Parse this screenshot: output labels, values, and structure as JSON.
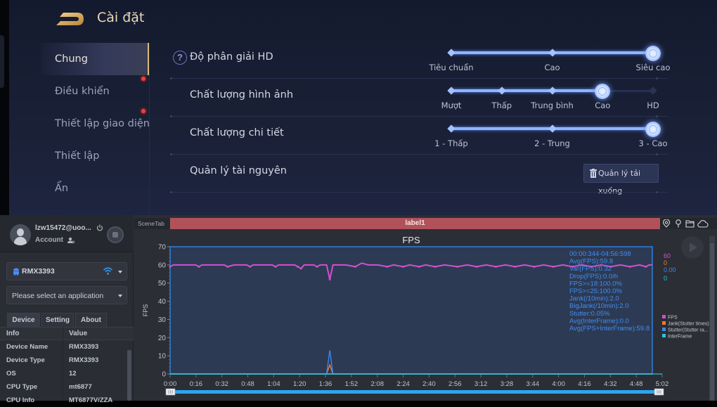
{
  "game_settings": {
    "title": "Cài đặt",
    "sidebar": [
      {
        "label": "Chung",
        "active": true,
        "badge": false
      },
      {
        "label": "Điều khiển",
        "active": false,
        "badge": true
      },
      {
        "label": "Thiết lập giao diện",
        "active": false,
        "badge": true
      },
      {
        "label": "Thiết lập",
        "active": false,
        "badge": false
      },
      {
        "label": "Ẩn",
        "active": false,
        "badge": false
      }
    ],
    "rows": [
      {
        "label": "Độ phân giải HD",
        "help": "?",
        "options": [
          "Tiêu chuẩn",
          "Cao",
          "Siêu cao"
        ],
        "selected_index": 2,
        "enabled_count": 3
      },
      {
        "label": "Chất lượng hình ảnh",
        "options": [
          "Mượt",
          "Thấp",
          "Trung bình",
          "Cao",
          "HD"
        ],
        "selected_index": 3,
        "enabled_count": 4
      },
      {
        "label": "Chất lượng chi tiết",
        "options": [
          "1 - Thấp",
          "2 - Trung",
          "3 - Cao"
        ],
        "selected_index": 2,
        "enabled_count": 3
      },
      {
        "label": "Quản lý tài nguyên",
        "button_label": "Quản lý tải xuống"
      }
    ]
  },
  "perf_tool": {
    "account": {
      "username": "lzw15472@uoo...",
      "label": "Account"
    },
    "device": {
      "name": "RMX3393"
    },
    "app_select": {
      "placeholder": "Please select an application"
    },
    "tabs": [
      "Device",
      "Setting",
      "About"
    ],
    "info_table": {
      "headers": [
        "Info",
        "Value"
      ],
      "rows": [
        [
          "Device Name",
          "RMX3393"
        ],
        [
          "Device Type",
          "RMX3393"
        ],
        [
          "OS",
          "12"
        ],
        [
          "CPU Type",
          "mt6877"
        ],
        [
          "CPU Info",
          "MT6877V/ZZA"
        ]
      ]
    },
    "scene_tab": "SceneTab",
    "label_bar": "label1",
    "colors": {
      "fps": "#d24fd0",
      "jank": "#f07d2a",
      "stutter": "#3d86ef",
      "interframe": "#27c6d8",
      "label_bar": "#b1525a"
    }
  },
  "chart_data": {
    "type": "line",
    "title": "FPS",
    "xlabel": "",
    "ylabel": "FPS",
    "ylim": [
      0,
      70
    ],
    "yticks": [
      0,
      10,
      20,
      30,
      40,
      50,
      60,
      70
    ],
    "xlim_seconds": [
      0,
      302
    ],
    "xtick_labels": [
      "0:00",
      "0:16",
      "0:32",
      "0:48",
      "1:04",
      "1:20",
      "1:36",
      "1:52",
      "2:08",
      "2:24",
      "2:40",
      "2:56",
      "3:12",
      "3:28",
      "3:44",
      "4:00",
      "4:16",
      "4:32",
      "4:48",
      "5:02"
    ],
    "series": [
      {
        "name": "FPS",
        "current": "60",
        "x": [
          0,
          2,
          4,
          10,
          16,
          18,
          20,
          30,
          34,
          36,
          40,
          48,
          50,
          52,
          64,
          66,
          68,
          78,
          80,
          82,
          84,
          86,
          90,
          92,
          94,
          98,
          100,
          102,
          106,
          108,
          110,
          116,
          120,
          124,
          130,
          136,
          140,
          146,
          150,
          156,
          160,
          166,
          172,
          180,
          186,
          192,
          198,
          204,
          210,
          216,
          222,
          228,
          234,
          240,
          246,
          252,
          258,
          264,
          270,
          276,
          282,
          288,
          294,
          298,
          300,
          302
        ],
        "y": [
          59,
          60,
          60,
          60,
          60,
          59,
          60,
          60,
          60,
          59,
          60,
          60,
          59,
          60,
          60,
          59,
          60,
          60,
          59,
          58,
          60,
          60,
          60,
          59,
          60,
          60,
          52,
          60,
          60,
          60,
          60,
          59,
          61,
          60,
          60,
          59,
          60,
          59,
          60,
          59,
          60,
          59,
          60,
          59,
          60,
          59,
          60,
          59,
          60,
          59,
          60,
          59,
          60,
          59,
          60,
          59,
          60,
          59,
          60,
          59,
          60,
          59,
          60,
          59,
          60,
          60
        ]
      },
      {
        "name": "Jank(Stutter times)",
        "current": "0",
        "x": [
          0,
          98,
          100,
          102,
          302
        ],
        "y": [
          0,
          0,
          5,
          0,
          0
        ]
      },
      {
        "name": "Stutter(Stutter ra...",
        "current": "0.00",
        "x": [
          0,
          98,
          100,
          102,
          302
        ],
        "y": [
          0,
          0,
          13,
          0,
          0
        ]
      },
      {
        "name": "InterFrame",
        "current": "0",
        "x": [
          0,
          302
        ],
        "y": [
          0,
          0
        ]
      }
    ],
    "stats": [
      "00:00:344-04:56:598",
      "Avg(FPS):59.8",
      "Var(FPS):0.32",
      "Drop(FPS):0.0/h",
      "FPS>=18:100.0%",
      "FPS>=25:100.0%",
      "Jank(/10min):2.0",
      "BigJank(/10min):2.0",
      "Stutter:0.05%",
      "Avg(InterFrame):0.0",
      "Avg(FPS+InterFrame):59.8"
    ],
    "legend_position": "right",
    "grid": false
  }
}
